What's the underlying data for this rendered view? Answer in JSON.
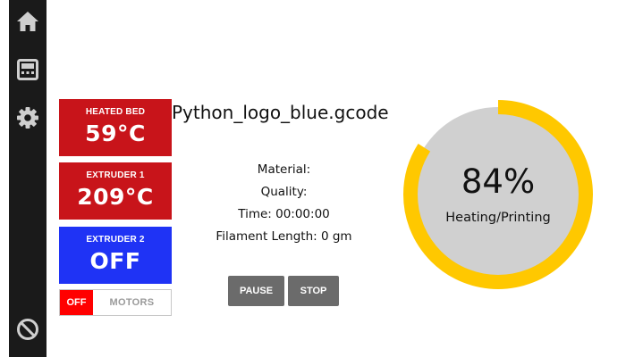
{
  "sidebar": {
    "items": [
      {
        "icon": "home-icon"
      },
      {
        "icon": "display-icon"
      },
      {
        "icon": "gear-icon"
      },
      {
        "icon": "cancel-icon"
      }
    ]
  },
  "temperatures": {
    "heated_bed": {
      "label": "HEATED BED",
      "value": "59°C",
      "color": "#c8141a"
    },
    "extruder1": {
      "label": "EXTRUDER 1",
      "value": "209°C",
      "color": "#c8141a"
    },
    "extruder2": {
      "label": "EXTRUDER 2",
      "value": "OFF",
      "color": "#1f33f5"
    }
  },
  "motors": {
    "state": "OFF",
    "label": "MOTORS"
  },
  "job": {
    "filename": "Python_logo_blue.gcode",
    "material": "Material:",
    "quality": "Quality:",
    "time": "Time: 00:00:00",
    "filament": "Filament Length: 0 gm"
  },
  "controls": {
    "pause": "PAUSE",
    "stop": "STOP"
  },
  "progress": {
    "percent_label": "84%",
    "percent": 84,
    "status": "Heating/Printing",
    "ring_color": "#ffc800",
    "track_color": "#d0d0d0"
  }
}
